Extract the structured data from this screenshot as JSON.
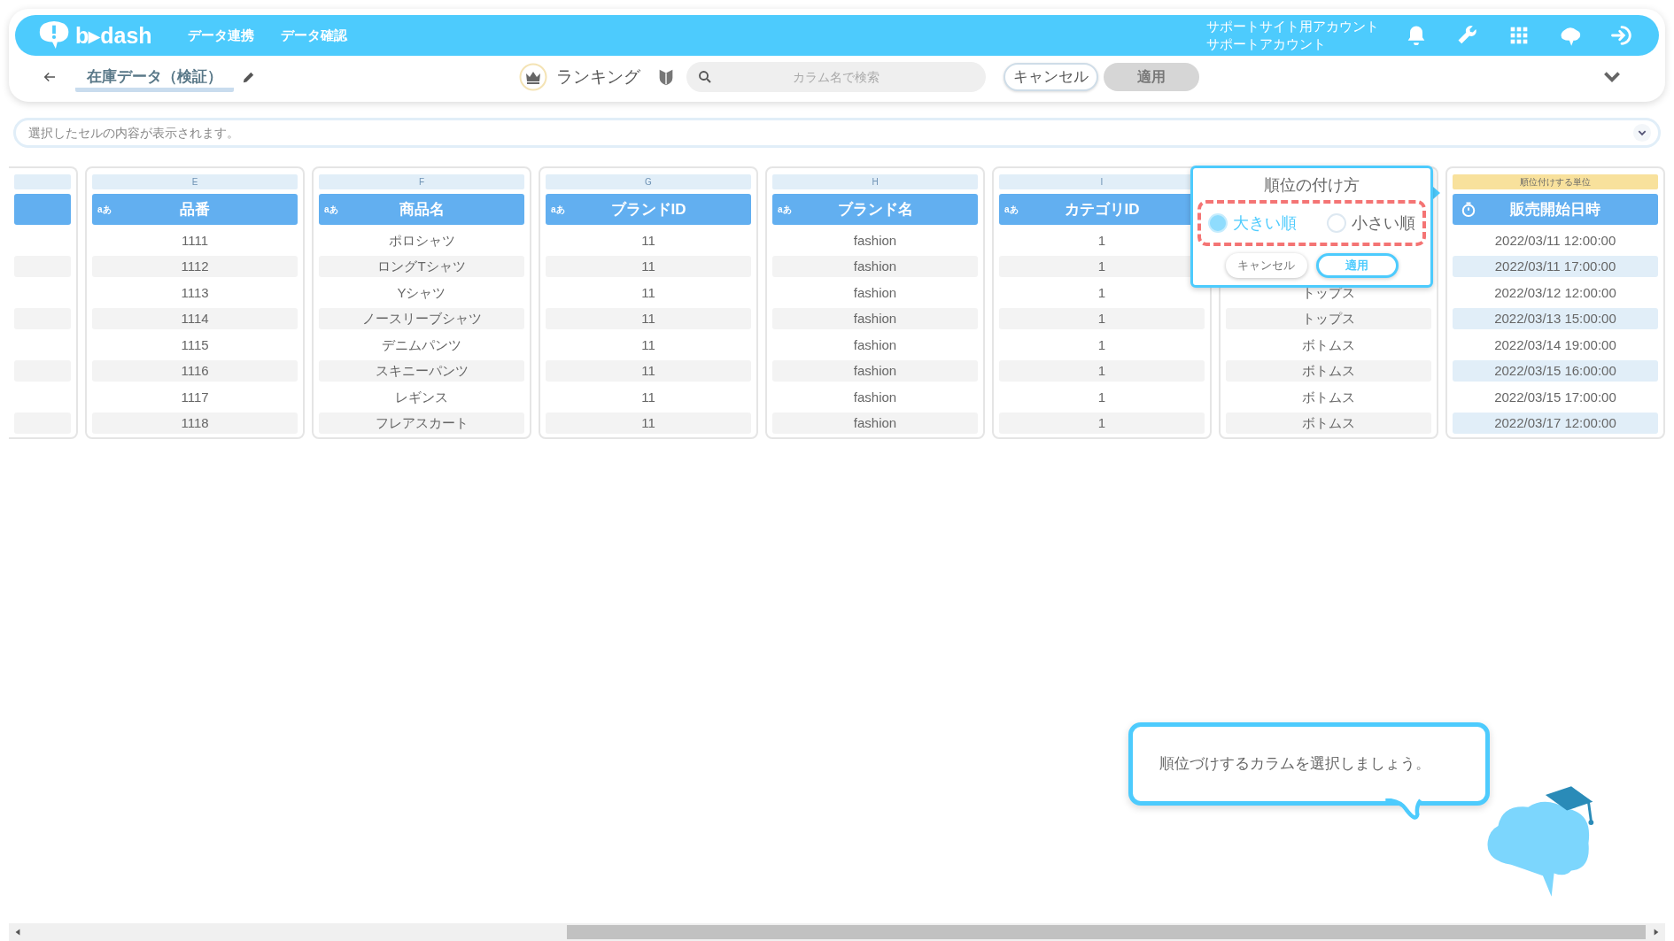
{
  "header": {
    "logo_text": "b▸dash",
    "nav": [
      "データ連携",
      "データ確認"
    ],
    "account": [
      "サポートサイト用アカウント",
      "サポートアカウント"
    ]
  },
  "toolbar": {
    "title": "在庫データ（検証）",
    "mode": "ランキング",
    "search": {
      "placeholder": "カラム名で検索"
    },
    "cancel": "キャンセル",
    "apply": {
      "label": "適用",
      "disabled": true
    }
  },
  "cell_bar": {
    "placeholder": "選択したセルの内容が表示されます。"
  },
  "columns": [
    {
      "kind": "text",
      "letter": "E",
      "type_label": "aあ",
      "title": "品番",
      "rows": [
        "1111",
        "1112",
        "1113",
        "1114",
        "1115",
        "1116",
        "1117",
        "1118"
      ]
    },
    {
      "kind": "text",
      "letter": "F",
      "type_label": "aあ",
      "title": "商品名",
      "rows": [
        "ポロシャツ",
        "ロングTシャツ",
        "Yシャツ",
        "ノースリーブシャツ",
        "デニムパンツ",
        "スキニーパンツ",
        "レギンス",
        "フレアスカート"
      ]
    },
    {
      "kind": "text",
      "letter": "G",
      "type_label": "aあ",
      "title": "ブランドID",
      "rows": [
        "11",
        "11",
        "11",
        "11",
        "11",
        "11",
        "11",
        "11"
      ]
    },
    {
      "kind": "text",
      "letter": "H",
      "type_label": "aあ",
      "title": "ブランド名",
      "rows": [
        "fashion",
        "fashion",
        "fashion",
        "fashion",
        "fashion",
        "fashion",
        "fashion",
        "fashion"
      ]
    },
    {
      "kind": "text",
      "letter": "I",
      "type_label": "aあ",
      "title": "カテゴリID",
      "rows": [
        "1",
        "1",
        "1",
        "1",
        "1",
        "1",
        "1",
        "1"
      ]
    },
    {
      "kind": "covered",
      "rows": [
        "トップス",
        "トップス",
        "ボトムス",
        "ボトムス",
        "ボトムス",
        "ボトムス"
      ]
    },
    {
      "kind": "datetime",
      "band": "順位付けする単位",
      "title": "販売開始日時",
      "rows": [
        "2022/03/11 12:00:00",
        "2022/03/11 17:00:00",
        "2022/03/12 12:00:00",
        "2022/03/13 15:00:00",
        "2022/03/14 19:00:00",
        "2022/03/15 16:00:00",
        "2022/03/15 17:00:00",
        "2022/03/17 12:00:00"
      ]
    }
  ],
  "popup": {
    "title": "順位の付け方",
    "options": [
      {
        "label": "大きい順",
        "selected": true
      },
      {
        "label": "小さい順",
        "selected": false
      }
    ],
    "cancel": "キャンセル",
    "apply": "適用"
  },
  "tip": {
    "text": "順位づけするカラムを選択しましょう。"
  }
}
